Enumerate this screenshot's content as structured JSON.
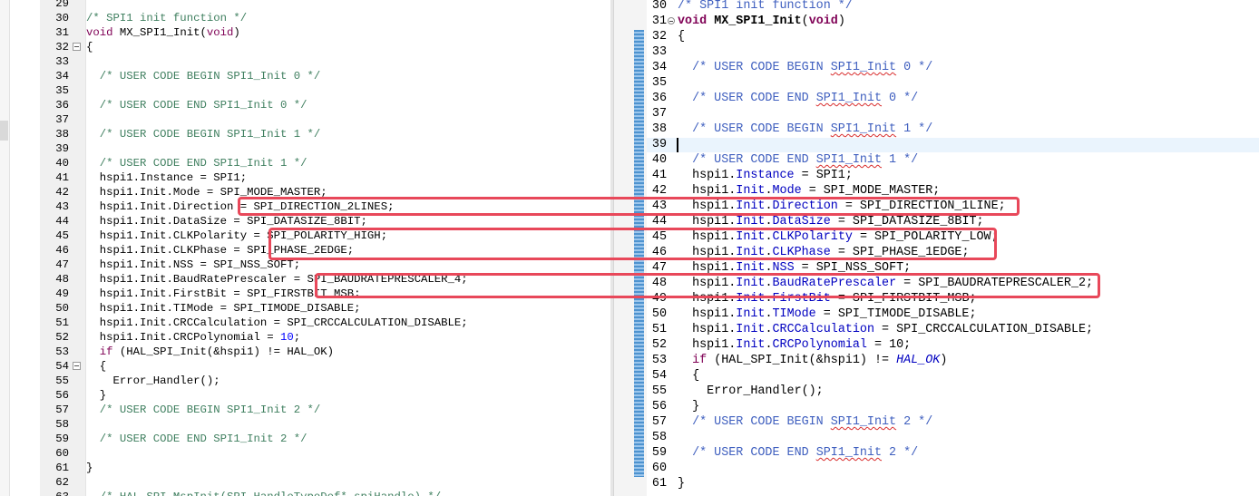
{
  "left_editor": {
    "lines": [
      {
        "n": "29",
        "t": "",
        "fold": false
      },
      {
        "n": "30",
        "t": "/* SPI1 init function */",
        "style": "cmtg",
        "fold": false
      },
      {
        "n": "31",
        "t": "void MX_SPI1_Init(void)",
        "style": "sig",
        "fold": false
      },
      {
        "n": "32",
        "t": "{",
        "fold": true
      },
      {
        "n": "33",
        "t": "",
        "fold": false
      },
      {
        "n": "34",
        "t": "  /* USER CODE BEGIN SPI1_Init 0 */",
        "style": "cmtg",
        "fold": false
      },
      {
        "n": "35",
        "t": "",
        "fold": false
      },
      {
        "n": "36",
        "t": "  /* USER CODE END SPI1_Init 0 */",
        "style": "cmtg",
        "fold": false
      },
      {
        "n": "37",
        "t": "",
        "fold": false
      },
      {
        "n": "38",
        "t": "  /* USER CODE BEGIN SPI1_Init 1 */",
        "style": "cmtg",
        "fold": false
      },
      {
        "n": "39",
        "t": "",
        "fold": false
      },
      {
        "n": "40",
        "t": "  /* USER CODE END SPI1_Init 1 */",
        "style": "cmtg",
        "fold": false
      },
      {
        "n": "41",
        "t": "  hspi1.Instance = SPI1;",
        "fold": false
      },
      {
        "n": "42",
        "t": "  hspi1.Init.Mode = SPI_MODE_MASTER;",
        "fold": false
      },
      {
        "n": "43",
        "t": "  hspi1.Init.Direction = SPI_DIRECTION_2LINES;",
        "fold": false
      },
      {
        "n": "44",
        "t": "  hspi1.Init.DataSize = SPI_DATASIZE_8BIT;",
        "fold": false
      },
      {
        "n": "45",
        "t": "  hspi1.Init.CLKPolarity = SPI_POLARITY_HIGH;",
        "fold": false
      },
      {
        "n": "46",
        "t": "  hspi1.Init.CLKPhase = SPI_PHASE_2EDGE;",
        "fold": false
      },
      {
        "n": "47",
        "t": "  hspi1.Init.NSS = SPI_NSS_SOFT;",
        "fold": false
      },
      {
        "n": "48",
        "t": "  hspi1.Init.BaudRatePrescaler = SPI_BAUDRATEPRESCALER_4;",
        "fold": false
      },
      {
        "n": "49",
        "t": "  hspi1.Init.FirstBit = SPI_FIRSTBIT_MSB;",
        "fold": false
      },
      {
        "n": "50",
        "t": "  hspi1.Init.TIMode = SPI_TIMODE_DISABLE;",
        "fold": false
      },
      {
        "n": "51",
        "t": "  hspi1.Init.CRCCalculation = SPI_CRCCALCULATION_DISABLE;",
        "fold": false
      },
      {
        "n": "52",
        "t": "  hspi1.Init.CRCPolynomial = 10;",
        "style": "num",
        "fold": false
      },
      {
        "n": "53",
        "t": "  if (HAL_SPI_Init(&hspi1) != HAL_OK)",
        "style": "if",
        "fold": false
      },
      {
        "n": "54",
        "t": "  {",
        "fold": true
      },
      {
        "n": "55",
        "t": "    Error_Handler();",
        "fold": false
      },
      {
        "n": "56",
        "t": "  }",
        "fold": false
      },
      {
        "n": "57",
        "t": "  /* USER CODE BEGIN SPI1_Init 2 */",
        "style": "cmtg",
        "fold": false
      },
      {
        "n": "58",
        "t": "",
        "fold": false
      },
      {
        "n": "59",
        "t": "  /* USER CODE END SPI1_Init 2 */",
        "style": "cmtg",
        "fold": false
      },
      {
        "n": "60",
        "t": "",
        "fold": false
      },
      {
        "n": "61",
        "t": "}",
        "fold": false
      },
      {
        "n": "62",
        "t": "",
        "fold": false
      },
      {
        "n": "63",
        "t": "  /* HAL_SPI_MspInit(SPI_HandleTypeDef* spiHandle) */",
        "style": "cmtg",
        "fold": false
      }
    ]
  },
  "right_editor": {
    "lines": [
      {
        "n": "30",
        "t": "/* SPI1 init function */",
        "style": "cmt",
        "fold": false
      },
      {
        "n": "31",
        "t": "void MX_SPI1_Init(void)",
        "style": "sigr",
        "fold": true
      },
      {
        "n": "32",
        "t": "{",
        "fold": false
      },
      {
        "n": "33",
        "t": "",
        "fold": false
      },
      {
        "n": "34",
        "t": "  /* USER CODE BEGIN SPI1_Init 0 */",
        "style": "cmt",
        "fold": false
      },
      {
        "n": "35",
        "t": "",
        "fold": false
      },
      {
        "n": "36",
        "t": "  /* USER CODE END SPI1_Init 0 */",
        "style": "cmt",
        "fold": false
      },
      {
        "n": "37",
        "t": "",
        "fold": false
      },
      {
        "n": "38",
        "t": "  /* USER CODE BEGIN SPI1_Init 1 */",
        "style": "cmt",
        "fold": false
      },
      {
        "n": "39",
        "t": "",
        "fold": false
      },
      {
        "n": "40",
        "t": "  /* USER CODE END SPI1_Init 1 */",
        "style": "cmt",
        "fold": false
      },
      {
        "n": "41",
        "t": "  hspi1.Instance = SPI1;",
        "style": "fieldr",
        "fold": false
      },
      {
        "n": "42",
        "t": "  hspi1.Init.Mode = SPI_MODE_MASTER;",
        "style": "fieldr",
        "fold": false
      },
      {
        "n": "43",
        "t": "  hspi1.Init.Direction = SPI_DIRECTION_1LINE;",
        "style": "fieldr",
        "fold": false
      },
      {
        "n": "44",
        "t": "  hspi1.Init.DataSize = SPI_DATASIZE_8BIT;",
        "style": "fieldr",
        "fold": false
      },
      {
        "n": "45",
        "t": "  hspi1.Init.CLKPolarity = SPI_POLARITY_LOW;",
        "style": "fieldr",
        "fold": false
      },
      {
        "n": "46",
        "t": "  hspi1.Init.CLKPhase = SPI_PHASE_1EDGE;",
        "style": "fieldr",
        "fold": false
      },
      {
        "n": "47",
        "t": "  hspi1.Init.NSS = SPI_NSS_SOFT;",
        "style": "fieldr",
        "fold": false
      },
      {
        "n": "48",
        "t": "  hspi1.Init.BaudRatePrescaler = SPI_BAUDRATEPRESCALER_2;",
        "style": "fieldr",
        "fold": false
      },
      {
        "n": "49",
        "t": "  hspi1.Init.FirstBit = SPI_FIRSTBIT_MSB;",
        "style": "fieldr",
        "fold": false
      },
      {
        "n": "50",
        "t": "  hspi1.Init.TIMode = SPI_TIMODE_DISABLE;",
        "style": "fieldr",
        "fold": false
      },
      {
        "n": "51",
        "t": "  hspi1.Init.CRCCalculation = SPI_CRCCALCULATION_DISABLE;",
        "style": "fieldr",
        "fold": false
      },
      {
        "n": "52",
        "t": "  hspi1.Init.CRCPolynomial = 10;",
        "style": "fieldr",
        "fold": false
      },
      {
        "n": "53",
        "t": "  if (HAL_SPI_Init(&hspi1) != HAL_OK)",
        "style": "ifr",
        "fold": false
      },
      {
        "n": "54",
        "t": "  {",
        "fold": false
      },
      {
        "n": "55",
        "t": "    Error_Handler();",
        "fold": false
      },
      {
        "n": "56",
        "t": "  }",
        "fold": false
      },
      {
        "n": "57",
        "t": "  /* USER CODE BEGIN SPI1_Init 2 */",
        "style": "cmt",
        "fold": false
      },
      {
        "n": "58",
        "t": "",
        "fold": false
      },
      {
        "n": "59",
        "t": "  /* USER CODE END SPI1_Init 2 */",
        "style": "cmt",
        "fold": false
      },
      {
        "n": "60",
        "t": "",
        "fold": false
      },
      {
        "n": "61",
        "t": "}",
        "fold": false
      }
    ]
  },
  "colors": {
    "highlight": "#e8485a",
    "comment_left": "#3f7f5f",
    "comment_right": "#3f5fbf",
    "keyword": "#7f0055",
    "field": "#0000c0",
    "current_line": "#eaf4fd",
    "diff_bar": "#4e93cf"
  }
}
